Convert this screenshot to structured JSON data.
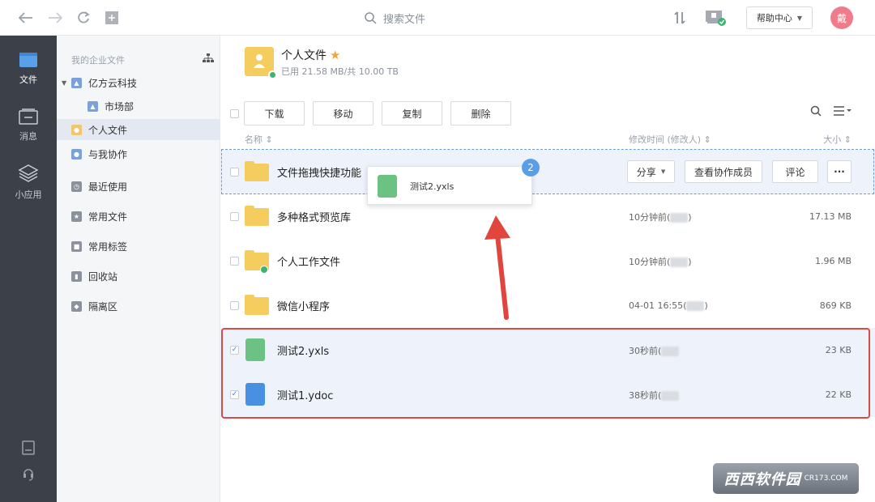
{
  "topbar": {
    "search_placeholder": "搜索文件",
    "help_label": "帮助中心",
    "avatar_text": "戴"
  },
  "rail": {
    "items": [
      {
        "label": "文件",
        "icon": "folder-icon"
      },
      {
        "label": "消息",
        "icon": "message-icon"
      },
      {
        "label": "小应用",
        "icon": "apps-icon"
      }
    ]
  },
  "sidebar": {
    "header": "我的企业文件",
    "items": [
      {
        "label": "亿方云科技"
      },
      {
        "label": "市场部"
      },
      {
        "label": "个人文件"
      },
      {
        "label": "与我协作"
      },
      {
        "label": "最近使用"
      },
      {
        "label": "常用文件"
      },
      {
        "label": "常用标签"
      },
      {
        "label": "回收站"
      },
      {
        "label": "隔离区"
      }
    ]
  },
  "main": {
    "title": "个人文件",
    "usage": "已用 21.58 MB/共 10.00 TB",
    "toolbar": {
      "download": "下载",
      "move": "移动",
      "copy": "复制",
      "delete": "删除"
    },
    "headers": {
      "name": "名称 ⇕",
      "modified": "修改时间 (修改人) ⇕",
      "size": "大小 ⇕"
    },
    "row_actions": {
      "share": "分享",
      "members": "查看协作成员",
      "comment": "评论",
      "more": "···"
    },
    "rows": [
      {
        "name": "文件拖拽快捷功能",
        "time": "",
        "size": ""
      },
      {
        "name": "多种格式预览库",
        "time": "10分钟前(",
        "size": "17.13 MB"
      },
      {
        "name": "个人工作文件",
        "time": "10分钟前(",
        "size": "1.96 MB"
      },
      {
        "name": "微信小程序",
        "time": "04-01 16:55(",
        "size": "869 KB"
      },
      {
        "name": "测试2.yxls",
        "time": "30秒前(",
        "size": "23 KB"
      },
      {
        "name": "测试1.ydoc",
        "time": "38秒前(",
        "size": "22 KB"
      }
    ],
    "drag": {
      "file_name": "测试2.yxls",
      "count": "2"
    }
  },
  "watermark": {
    "text": "西西软件园",
    "sub": "CR173.COM"
  },
  "colors": {
    "accent_blue": "#4a90e2",
    "selection_red": "#d74b4b",
    "folder_yellow": "#f5cc5e",
    "rail_dark": "#3c4049"
  }
}
